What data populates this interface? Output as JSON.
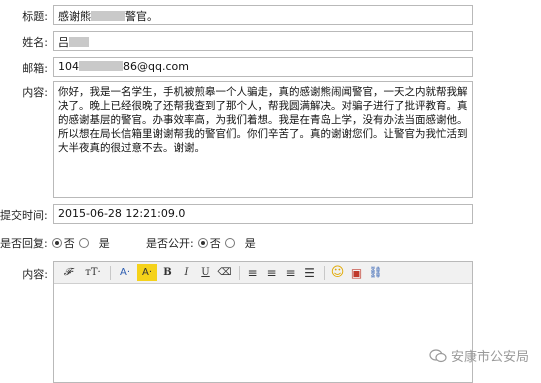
{
  "form": {
    "title_label": "标题:",
    "title_before": "感谢熊",
    "title_after": "警官。",
    "name_label": "姓名:",
    "name_value": "吕",
    "email_label": "邮箱:",
    "email_before": "104",
    "email_after": "86@qq.com",
    "content_label": "内容:",
    "content_value": "你好，我是一名学生，手机被煎皋一个人骗走，真的感谢熊闹闻警官，一天之内就帮我解决了。晚上已经很晚了还帮我查到了那个人，帮我圆满解决。对骗子进行了批评教育。真的感谢基层的警官。办事效率高，为我们着想。我是在青岛上学，没有办法当面感谢他。所以想在局长信箱里谢谢帮我的警官们。你们辛苦了。真的谢谢您们。让警官为我忙活到大半夜真的很过意不去。谢谢。",
    "time_label": "提交时间:",
    "time_value": "2015-06-28 12:21:09.0",
    "reply_label": "是否回复:",
    "reply_no": "否",
    "reply_yes": "是",
    "public_label": "是否公开:",
    "public_no": "否",
    "public_yes": "是",
    "body_label": "内容:"
  },
  "toolbar": {
    "font_family": "𝓕·",
    "font_size": "тT·",
    "font_color": "A·",
    "bg_color": "A·",
    "bold": "B",
    "italic": "I",
    "underline": "U",
    "eraser": "⌫",
    "align_left": "≡",
    "align_center": "≡",
    "align_right": "≡",
    "list": "☰",
    "emoji": "☺",
    "image": "▣",
    "link": "⛓"
  },
  "watermark": {
    "text": "安康市公安局"
  }
}
